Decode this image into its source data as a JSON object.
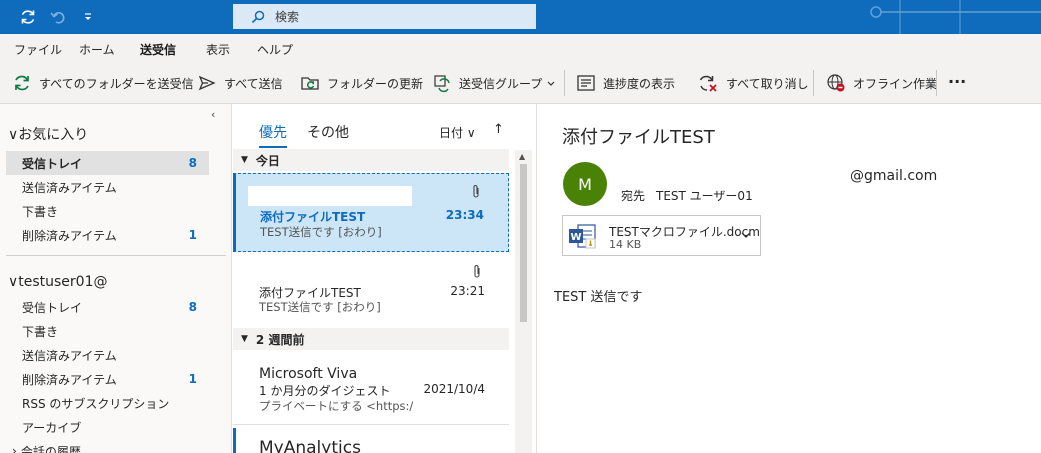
{
  "titlebar": {
    "search_placeholder": "検索",
    "icons": [
      "sync-icon",
      "undo-icon",
      "customize-toolbar-icon",
      "search-icon"
    ]
  },
  "menu": {
    "tabs": [
      {
        "label": "ファイル"
      },
      {
        "label": "ホーム"
      },
      {
        "label": "送受信",
        "active": true
      },
      {
        "label": "表示"
      },
      {
        "label": "ヘルプ"
      }
    ]
  },
  "ribbon": {
    "send_receive_all": "すべてのフォルダーを送受信",
    "send_all": "すべて送信",
    "update_folder": "フォルダーの更新",
    "send_receive_groups": "送受信グループ",
    "show_progress": "進捗度の表示",
    "cancel_all": "すべて取り消し",
    "work_offline": "オフライン作業",
    "more": "···"
  },
  "folders": {
    "favorites_label": "お気に入り",
    "favorites": [
      {
        "label": "受信トレイ",
        "count": "8",
        "selected": true
      },
      {
        "label": "送信済みアイテム",
        "count": ""
      },
      {
        "label": "下書き",
        "count": ""
      },
      {
        "label": "削除済みアイテム",
        "count": "1"
      }
    ],
    "account_label": "testuser01@",
    "account_items": [
      {
        "label": "受信トレイ",
        "count": "8"
      },
      {
        "label": "下書き",
        "count": ""
      },
      {
        "label": "送信済みアイテム",
        "count": ""
      },
      {
        "label": "削除済みアイテム",
        "count": "1"
      },
      {
        "label": "RSS のサブスクリプション",
        "count": ""
      },
      {
        "label": "アーカイブ",
        "count": ""
      },
      {
        "label": "会話の履歴",
        "count": ""
      }
    ]
  },
  "list": {
    "tab_focused": "優先",
    "tab_other": "その他",
    "sort_label": "日付",
    "sort_dir": "↑",
    "groups": {
      "today": "今日",
      "two_weeks": "2 週間前"
    },
    "messages": [
      {
        "sender": "",
        "subject": "添付ファイルTEST",
        "time": "23:34",
        "preview": "TEST送信です [おわり]"
      },
      {
        "sender": "",
        "subject": "添付ファイルTEST",
        "time": "23:21",
        "preview": "TEST送信です [おわり]"
      },
      {
        "sender": "Microsoft Viva",
        "subject": "1 か月分のダイジェスト",
        "time": "2021/10/4",
        "preview": "プライベートにする <https:/"
      },
      {
        "sender": "MyAnalytics",
        "subject": "",
        "time": "",
        "preview": ""
      }
    ]
  },
  "reading": {
    "subject": "添付ファイルTEST",
    "avatar_initial": "M",
    "from_email": "@gmail.com",
    "to_label": "宛先",
    "to_name": "TEST ユーザー01",
    "attachment": {
      "name": "TESTマクロファイル.docm",
      "size": "14 KB"
    },
    "body": "TEST 送信です"
  },
  "colors": {
    "accent": "#0f6cbd",
    "avatar": "#498205",
    "selected_msg": "#cde6f7"
  }
}
